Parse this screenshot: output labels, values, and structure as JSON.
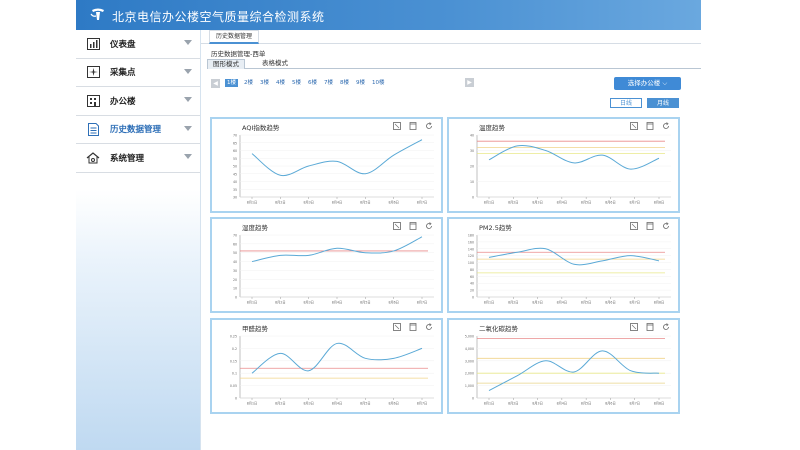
{
  "app": {
    "title": "北京电信办公楼空气质量综合检测系统"
  },
  "sidebar": {
    "items": [
      {
        "label": "仪表盘",
        "icon": "dashboard-icon"
      },
      {
        "label": "采集点",
        "icon": "sensor-icon"
      },
      {
        "label": "办公楼",
        "icon": "building-icon"
      },
      {
        "label": "历史数据管理",
        "icon": "document-icon"
      },
      {
        "label": "系统管理",
        "icon": "settings-icon"
      }
    ],
    "active_index": 3
  },
  "tab": {
    "label": "历史数据管理"
  },
  "page": {
    "subtitle": "历史数据管理-西单"
  },
  "view_tabs": [
    "图形模式",
    "表格模式"
  ],
  "floors": [
    "1楼",
    "2楼",
    "3楼",
    "4楼",
    "5楼",
    "6楼",
    "7楼",
    "8楼",
    "9楼",
    "10楼"
  ],
  "active_floor": 0,
  "buttons": {
    "select_office": "选择办公楼",
    "day": "日线",
    "month": "月线"
  },
  "colors": {
    "accent": "#4b91d3",
    "panel_border": "#a9d3f0",
    "line": "#5aa9d6",
    "ref_red": "#e98b8b",
    "ref_yellow": "#e8e88a"
  },
  "panels": [
    {
      "title": "AQI指数趋势",
      "y_ticks": [
        "70",
        "65",
        "60",
        "55",
        "50",
        "45",
        "40",
        "35",
        "30"
      ],
      "x_ticks": [
        "8月1日",
        "8月2日",
        "8月3日",
        "8月4日",
        "8月5日",
        "8月6日",
        "8月7日"
      ],
      "ref_lines": []
    },
    {
      "title": "温度趋势",
      "y_ticks": [
        "40",
        "30",
        "20",
        "10",
        "0"
      ],
      "x_ticks": [
        "8月1日",
        "8月2日",
        "8月3日",
        "8月4日",
        "8月5日",
        "8月6日",
        "8月7日",
        "8月8日"
      ],
      "ref_lines": []
    },
    {
      "title": "湿度趋势",
      "y_ticks": [
        "70",
        "60",
        "50",
        "40",
        "30",
        "20",
        "10",
        "0"
      ],
      "x_ticks": [
        "8月1日",
        "8月2日",
        "8月3日",
        "8月4日",
        "8月5日",
        "8月6日",
        "8月7日"
      ],
      "ref_lines": []
    },
    {
      "title": "PM2.5趋势",
      "y_ticks": [
        "180",
        "160",
        "140",
        "120",
        "100",
        "80",
        "60",
        "40",
        "20",
        "0"
      ],
      "x_ticks": [
        "8月1日",
        "8月2日",
        "8月3日",
        "8月4日",
        "8月5日",
        "8月6日",
        "8月7日",
        "8月8日"
      ],
      "ref_lines": []
    },
    {
      "title": "甲醛趋势",
      "y_ticks": [
        "0.25",
        "0.2",
        "0.15",
        "0.1",
        "0.05",
        "0"
      ],
      "x_ticks": [
        "8月1日",
        "8月2日",
        "8月3日",
        "8月4日",
        "8月5日",
        "8月6日",
        "8月7日"
      ],
      "ref_lines": []
    },
    {
      "title": "二氧化碳趋势",
      "y_ticks": [
        "5,000",
        "4,000",
        "3,000",
        "2,000",
        "1,000",
        "0"
      ],
      "x_ticks": [
        "8月1日",
        "8月2日",
        "8月3日",
        "8月4日",
        "8月5日",
        "8月6日",
        "8月7日",
        "8月8日"
      ],
      "ref_lines": []
    }
  ],
  "chart_data": [
    {
      "type": "line",
      "title": "AQI指数趋势",
      "x": [
        "8月1日",
        "8月2日",
        "8月3日",
        "8月4日",
        "8月5日",
        "8月6日",
        "8月7日"
      ],
      "ylim": [
        30,
        70
      ],
      "values": [
        58,
        44,
        50,
        53,
        45,
        57,
        67
      ],
      "ref_values": []
    },
    {
      "type": "line",
      "title": "温度趋势",
      "x": [
        "8月1日",
        "8月2日",
        "8月3日",
        "8月4日",
        "8月5日",
        "8月6日",
        "8月7日",
        "8月8日"
      ],
      "ylim": [
        0,
        40
      ],
      "values": [
        24,
        33,
        30,
        22,
        27,
        18,
        25
      ],
      "ref_values": [
        36,
        32,
        28
      ]
    },
    {
      "type": "line",
      "title": "湿度趋势",
      "x": [
        "8月1日",
        "8月2日",
        "8月3日",
        "8月4日",
        "8月5日",
        "8月6日",
        "8月7日"
      ],
      "ylim": [
        0,
        70
      ],
      "values": [
        40,
        47,
        47,
        55,
        50,
        52,
        68
      ],
      "ref_values": [
        52
      ]
    },
    {
      "type": "line",
      "title": "PM2.5趋势",
      "x": [
        "8月1日",
        "8月2日",
        "8月3日",
        "8月4日",
        "8月5日",
        "8月6日",
        "8月7日",
        "8月8日"
      ],
      "ylim": [
        0,
        180
      ],
      "values": [
        115,
        130,
        140,
        95,
        105,
        120,
        105
      ],
      "ref_values": [
        130,
        110,
        70
      ]
    },
    {
      "type": "line",
      "title": "甲醛趋势",
      "x": [
        "8月1日",
        "8月2日",
        "8月3日",
        "8月4日",
        "8月5日",
        "8月6日",
        "8月7日"
      ],
      "ylim": [
        0,
        0.25
      ],
      "values": [
        0.1,
        0.18,
        0.11,
        0.22,
        0.16,
        0.16,
        0.2
      ],
      "ref_values": [
        0.12,
        0.08
      ]
    },
    {
      "type": "line",
      "title": "二氧化碳趋势",
      "x": [
        "8月1日",
        "8月2日",
        "8月3日",
        "8月4日",
        "8月5日",
        "8月6日",
        "8月7日",
        "8月8日"
      ],
      "ylim": [
        0,
        5000
      ],
      "values": [
        600,
        1800,
        3000,
        2100,
        3800,
        2200,
        2000
      ],
      "ref_values": [
        4800,
        3200,
        2000,
        1200
      ]
    }
  ]
}
